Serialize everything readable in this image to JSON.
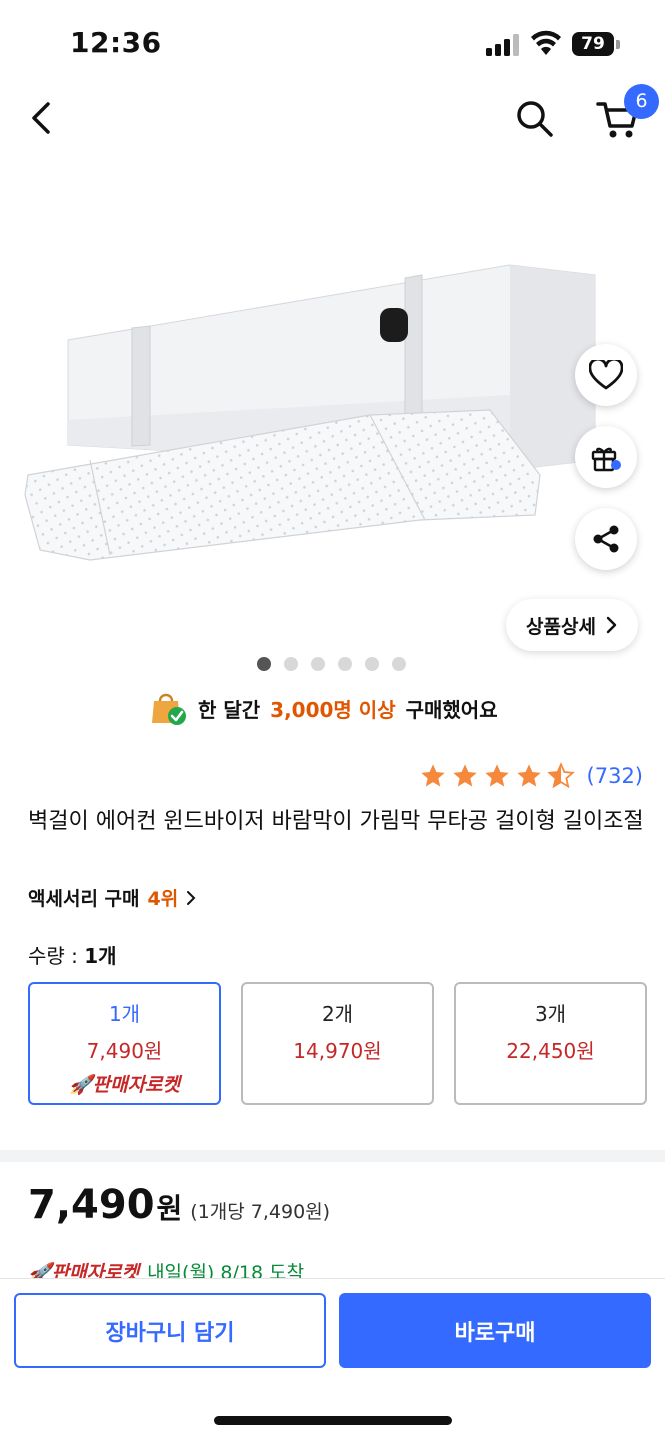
{
  "status_bar": {
    "time": "12:36",
    "battery": "79"
  },
  "nav": {
    "cart_count": "6"
  },
  "detail_button": {
    "label": "상품상세"
  },
  "carousel": {
    "total": 6,
    "active": 1
  },
  "buyers": {
    "prefix": "한 달간",
    "count": "3,000명 이상",
    "suffix": "구매했어요"
  },
  "rating": {
    "stars": 4.5,
    "count": "(732)"
  },
  "product": {
    "title": "벽걸이 에어컨 윈드바이저 바람막이 가림막 무타공 걸이형 길이조절",
    "ranking_prefix": "액세서리 구매",
    "ranking_num": "4위"
  },
  "quantity": {
    "label": "수량 :",
    "value": "1개",
    "options": [
      {
        "name": "1개",
        "price": "7,490원",
        "badge": "판매자로켓"
      },
      {
        "name": "2개",
        "price": "14,970원"
      },
      {
        "name": "3개",
        "price": "22,450원"
      }
    ]
  },
  "price": {
    "amount": "7,490",
    "unit": "원",
    "per_unit": "(1개당 7,490원)"
  },
  "delivery": {
    "badge": "판매자로켓",
    "eta": "내일(월) 8/18 도착"
  },
  "actions": {
    "cart": "장바구니 담기",
    "buy": "바로구매"
  },
  "colors": {
    "accent": "#346aff",
    "price_red": "#c62828",
    "highlight_orange": "#e05500",
    "star": "#f5883a"
  },
  "icons": [
    "back-arrow-icon",
    "search-icon",
    "cart-icon",
    "heart-icon",
    "gift-icon",
    "share-icon",
    "chevron-right-icon",
    "shopping-bag-check-icon",
    "rocket-icon",
    "star-icon"
  ]
}
